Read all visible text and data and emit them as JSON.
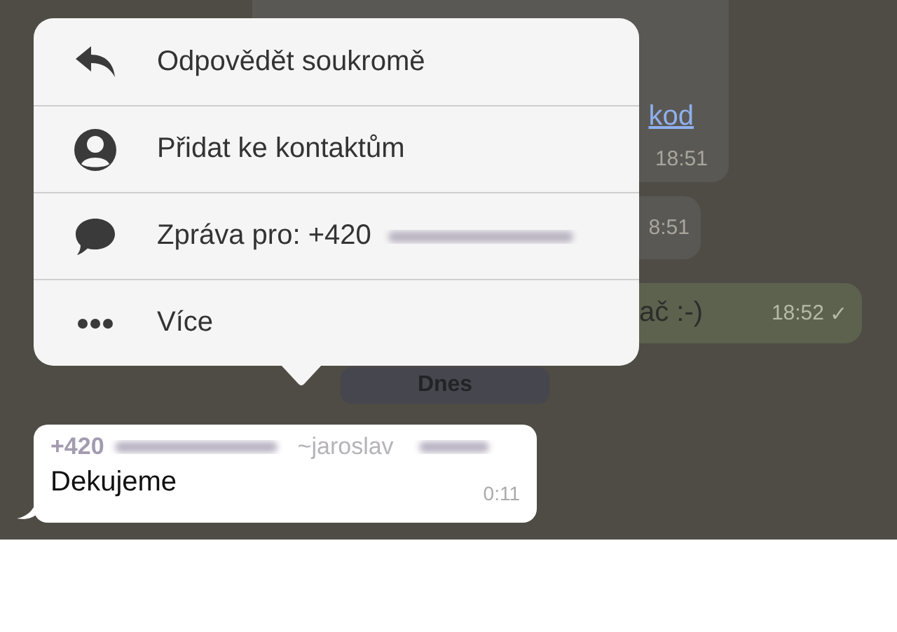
{
  "chat": {
    "messages": [
      {
        "kind": "incoming",
        "link": "kod",
        "time": "18:51"
      },
      {
        "kind": "incoming",
        "time": "8:51"
      },
      {
        "kind": "outgoing",
        "text": "ač :-)",
        "time": "18:52",
        "tick": "✓"
      }
    ],
    "date_divider": "Dnes",
    "selected_message": {
      "sender": "+420",
      "sender_name": "~jaroslav",
      "text": "Dekujeme",
      "time": "0:11"
    }
  },
  "context_menu": {
    "items": [
      {
        "kind": "reply",
        "label": "Odpovědět soukromě",
        "redacted": false
      },
      {
        "kind": "contact",
        "label": "Přidat ke kontaktům",
        "redacted": false
      },
      {
        "kind": "message",
        "label": "Zpráva pro: +420",
        "redacted": true
      },
      {
        "kind": "more",
        "label": "Více",
        "redacted": false
      }
    ]
  }
}
